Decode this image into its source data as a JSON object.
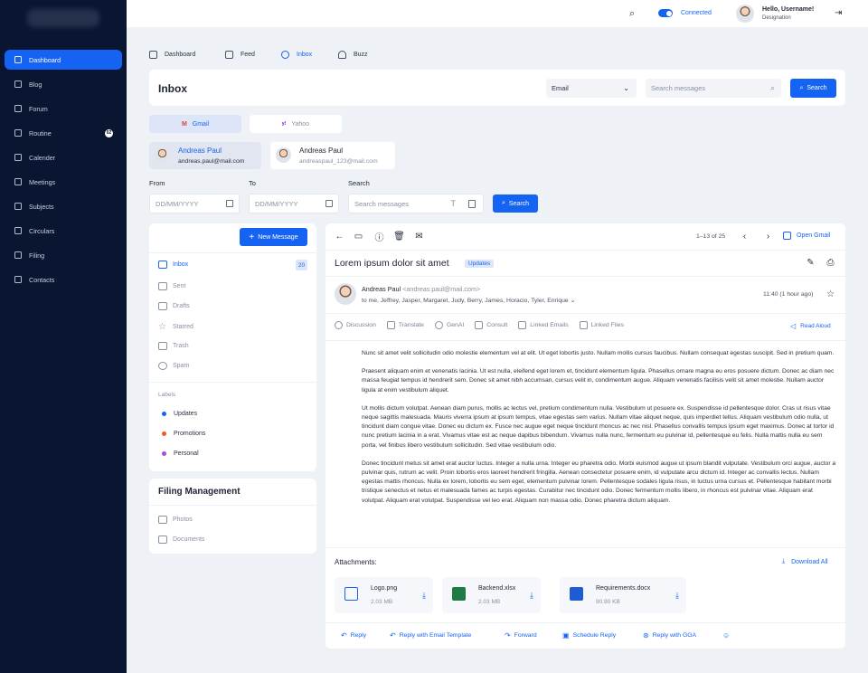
{
  "sidebar": {
    "items": [
      {
        "label": "Dashboard"
      },
      {
        "label": "Blog"
      },
      {
        "label": "Forum"
      },
      {
        "label": "Routine",
        "badge": "02"
      },
      {
        "label": "Calender"
      },
      {
        "label": "Meetings"
      },
      {
        "label": "Subjects"
      },
      {
        "label": "Circulars"
      },
      {
        "label": "Filing"
      },
      {
        "label": "Contacts"
      }
    ]
  },
  "topbar": {
    "connected_label": "Connected",
    "user_name": "Hello, Username!",
    "user_role": "Designation"
  },
  "tabs": [
    {
      "label": "Dashboard"
    },
    {
      "label": "Feed"
    },
    {
      "label": "Inbox"
    },
    {
      "label": "Buzz"
    }
  ],
  "inbox": {
    "title": "Inbox",
    "provider_select": "Email",
    "search_placeholder": "Search messages",
    "search_button": "Search"
  },
  "providers": {
    "gmail": "Gmail",
    "yahoo": "Yahoo"
  },
  "accounts": [
    {
      "name": "Andreas Paul",
      "email": "andreas.paul@mail.com"
    },
    {
      "name": "Andreas Paul",
      "email": "andreaspaul_123@mail.com"
    }
  ],
  "filters": {
    "from_label": "From",
    "to_label": "To",
    "search_label": "Search",
    "date_placeholder": "DD/MM/YYYY",
    "search_placeholder": "Search messages",
    "search_button": "Search"
  },
  "folders": {
    "new_message": "New Message",
    "items": [
      {
        "label": "Inbox",
        "count": "20"
      },
      {
        "label": "Sent"
      },
      {
        "label": "Drafts"
      },
      {
        "label": "Starred"
      },
      {
        "label": "Trash"
      },
      {
        "label": "Spam"
      }
    ],
    "labels_title": "Labels",
    "labels": [
      {
        "label": "Updates",
        "color": "#1563f3"
      },
      {
        "label": "Promotions",
        "color": "#f05a1a"
      },
      {
        "label": "Personal",
        "color": "#a04ce8"
      }
    ]
  },
  "filing": {
    "title": "Filing Management",
    "items": [
      {
        "label": "Photos"
      },
      {
        "label": "Documents"
      }
    ]
  },
  "message": {
    "pagination": "1–13 of 25",
    "open_gmail": "Open Gmail",
    "subject": "Lorem ipsum dolor sit amet",
    "tag": "Updates",
    "sender_name": "Andreas Paul",
    "sender_email": "<andreas.paul@mail.com>",
    "recipients": "to me, Jeffrey, Jasper, Margaret, Judy, Berry, James, Horacio, Tyler, Enrique",
    "time": "11:40 (1 hour ago)",
    "tools": [
      {
        "label": "Discussion"
      },
      {
        "label": "Translate"
      },
      {
        "label": "GenAI"
      },
      {
        "label": "Consult"
      },
      {
        "label": "Linked Emails"
      },
      {
        "label": "Linked Files"
      }
    ],
    "read_aloud": "Read Aloud",
    "body": [
      "Nunc sit amet velit sollicitudin odio molestie elementum vel at elit. Ut eget lobortis justo. Nullam mollis cursus faucibus. Nullam consequat egestas suscipit. Sed in pretium quam.",
      "Praesent aliquam enim et venenatis lacinia. Ut est nulla, eleifend eget lorem et, tincidunt elementum ligula. Phasellus ornare magna eu eros posuere dictum. Donec ac diam nec massa feugiat tempus id hendrerit sem. Donec sit amet nibh accumsan, cursus velit in, condimentum augue. Aliquam venenatis facilisis velit sit amet molestie. Nullam auctor ligula at enim vestibulum aliquet.",
      "Ut mollis dictum volutpat. Aenean diam purus, mollis ac lectus vel, pretium condimentum nulla. Vestibulum ut posuere ex. Suspendisse id pellentesque dolor. Cras ut risus vitae neque sagittis malesuada. Mauris viverra ipsum at ipsum tempus, vitae egestas sem varius. Nullam vitae aliquet neque, quis imperdiet tellus. Aliquam vestibulum odio nulla, ut tincidunt diam congue vitae. Donec eu dictum ex. Fusce nec augue eget neque tincidunt rhoncus ac nec nisl. Phasellus convallis tempus ipsum eget maximus. Donec at tortor id nunc pretium lacinia in a erat. Vivamus vitae est ac neque dapibus bibendum. Vivamus nulla nunc, fermentum eu pulvinar id, pellentesque eu felis. Nulla mattis nulla eu sem porta, vel finibus libero vestibulum sollicitudin. Sed vitae vestibulum odio.",
      "Donec tincidunt metus sit amet erat auctor luctus. Integer a nulla urna. Integer eu pharetra odio. Morbi euismod augue ut ipsum blandit vulputate. Vestibulum orci augue, auctor a pulvinar quis, rutrum ac velit. Proin lobortis eros laoreet hendrerit fringilla. Aenean consectetur posuere enim, id vulputate arcu dictum id. Integer ac convallis lectus. Nullam egestas mattis rhoncus. Nulla ex lorem, lobortis eu sem eget, elementum pulvinar lorem. Pellentesque sodales ligula risus, in luctus urna cursus et. Pellentesque habitant morbi tristique senectus et netus et malesuada fames ac turpis egestas. Curabitur nec tincidunt odio. Donec fermentum mollis libero, in rhoncus est pulvinar vitae. Aliquam erat volutpat. Aliquam erat volutpat. Suspendisse vel leo erat. Aliquam non massa odio. Donec pharetra dictum aliquam."
    ],
    "attachments_title": "Attachments:",
    "download_all": "Download All",
    "attachments": [
      {
        "name": "Logo.png",
        "size": "2.03 MB"
      },
      {
        "name": "Backend.xlsx",
        "size": "2.03 MB"
      },
      {
        "name": "Requirements.docx",
        "size": "90.90 KB"
      }
    ],
    "actions": [
      {
        "label": "Reply"
      },
      {
        "label": "Reply with Email Template"
      },
      {
        "label": "Forward"
      },
      {
        "label": "Schedule Reply"
      },
      {
        "label": "Reply with GGA"
      }
    ]
  },
  "colors": {
    "accent": "#1563f3",
    "sidebar": "#0a1631",
    "excel": "#1e7b45",
    "word": "#1f5bd1"
  }
}
